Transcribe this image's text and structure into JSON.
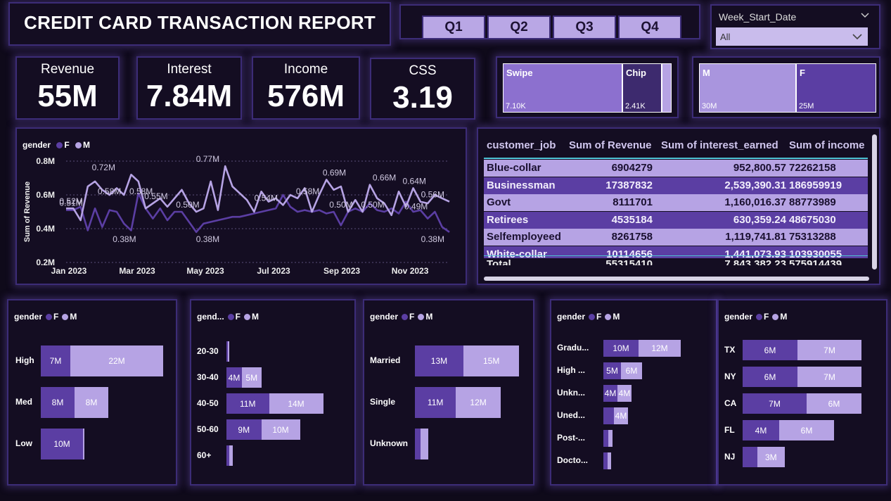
{
  "header": {
    "title": "CREDIT CARD TRANSACTION REPORT"
  },
  "quarters": [
    "Q1",
    "Q2",
    "Q3",
    "Q4"
  ],
  "filter": {
    "label": "Week_Start_Date",
    "value": "All"
  },
  "kpis": [
    {
      "label": "Revenue",
      "value": "55M"
    },
    {
      "label": "Interest",
      "value": "7.84M"
    },
    {
      "label": "Income",
      "value": "576M"
    },
    {
      "label": "CSS",
      "value": "3.19"
    }
  ],
  "card_type": [
    {
      "label": "Swipe",
      "value": "7.10K",
      "color": "#8c70cf"
    },
    {
      "label": "Chip",
      "value": "2.41K",
      "color": "#3d2a6e"
    }
  ],
  "gender_tiles": [
    {
      "label": "M",
      "value": "30M",
      "color": "#8c70cf"
    },
    {
      "label": "F",
      "value": "25M",
      "color": "#5b3ea3"
    }
  ],
  "colors": {
    "F": "#5b3ea3",
    "M": "#b6a3e4",
    "accent": "#3c2c77"
  },
  "legend": {
    "title": "gender",
    "short_title": "gend...",
    "F": "F",
    "M": "M"
  },
  "line_chart": {
    "ylabel": "Sum of Revenue",
    "y_ticks": [
      "0.8M",
      "0.6M",
      "0.4M",
      "0.2M"
    ],
    "x_ticks": [
      "Jan 2023",
      "Mar 2023",
      "May 2023",
      "Jul 2023",
      "Sep 2023",
      "Nov 2023"
    ],
    "annotations": [
      {
        "text": "0.72M",
        "x": 45,
        "y": 0.72
      },
      {
        "text": "0.58M",
        "x": 52,
        "y": 0.58
      },
      {
        "text": "0.58M",
        "x": 90,
        "y": 0.58
      },
      {
        "text": "0.52M",
        "x": 6,
        "y": 0.52
      },
      {
        "text": "0.51M",
        "x": 6,
        "y": 0.51
      },
      {
        "text": "0.55M",
        "x": 108,
        "y": 0.55
      },
      {
        "text": "0.50M",
        "x": 146,
        "y": 0.5
      },
      {
        "text": "0.38M",
        "x": 70,
        "y": 0.38
      },
      {
        "text": "0.77M",
        "x": 170,
        "y": 0.77
      },
      {
        "text": "0.38M",
        "x": 170,
        "y": 0.38
      },
      {
        "text": "0.54M",
        "x": 240,
        "y": 0.54
      },
      {
        "text": "0.58M",
        "x": 290,
        "y": 0.58
      },
      {
        "text": "0.69M",
        "x": 322,
        "y": 0.69
      },
      {
        "text": "0.50M",
        "x": 330,
        "y": 0.5
      },
      {
        "text": "0.50M",
        "x": 368,
        "y": 0.5
      },
      {
        "text": "0.66M",
        "x": 382,
        "y": 0.66
      },
      {
        "text": "0.64M",
        "x": 418,
        "y": 0.64
      },
      {
        "text": "0.49M",
        "x": 420,
        "y": 0.49
      },
      {
        "text": "0.56M",
        "x": 440,
        "y": 0.56
      },
      {
        "text": "0.38M",
        "x": 440,
        "y": 0.38
      }
    ]
  },
  "table": {
    "headers": [
      "customer_job",
      "Sum of Revenue",
      "Sum of interest_earned",
      "Sum of income"
    ],
    "rows": [
      [
        "Blue-collar",
        "6904279",
        "952,800.57",
        "72262158"
      ],
      [
        "Businessman",
        "17387832",
        "2,539,390.31",
        "186959919"
      ],
      [
        "Govt",
        "8111701",
        "1,160,016.37",
        "88773989"
      ],
      [
        "Retirees",
        "4535184",
        "630,359.24",
        "48675030"
      ],
      [
        "Selfemployeed",
        "8261758",
        "1,119,741.81",
        "75313288"
      ],
      [
        "White-collar",
        "10114656",
        "1,441,073.93",
        "103930055"
      ]
    ],
    "total": [
      "Total",
      "55315410",
      "7,843,382.23",
      "575914439"
    ]
  },
  "chart_data": [
    {
      "type": "line",
      "title": "",
      "xlabel": "",
      "ylabel": "Sum of Revenue",
      "ylim": [
        0.2,
        0.8
      ],
      "x_ticks": [
        "Jan 2023",
        "Mar 2023",
        "May 2023",
        "Jul 2023",
        "Sep 2023",
        "Nov 2023"
      ],
      "series": [
        {
          "name": "F",
          "values": [
            0.51,
            0.51,
            0.53,
            0.39,
            0.52,
            0.41,
            0.51,
            0.5,
            0.43,
            0.39,
            0.61,
            0.52,
            0.46,
            0.52,
            0.45,
            0.5,
            0.5,
            0.44,
            0.38,
            0.43,
            0.44,
            0.45,
            0.46,
            0.47,
            0.47,
            0.48,
            0.49,
            0.5,
            0.51,
            0.52,
            0.6,
            0.53,
            0.5,
            0.51,
            0.5,
            0.51,
            0.49,
            0.5,
            0.42,
            0.5,
            0.52,
            0.5,
            0.55,
            0.51,
            0.5,
            0.52,
            0.49,
            0.56,
            0.5,
            0.51,
            0.46,
            0.5,
            0.41,
            0.38
          ]
        },
        {
          "name": "M",
          "values": [
            0.52,
            0.52,
            0.45,
            0.65,
            0.68,
            0.63,
            0.6,
            0.64,
            0.6,
            0.72,
            0.68,
            0.52,
            0.55,
            0.58,
            0.53,
            0.58,
            0.63,
            0.55,
            0.5,
            0.52,
            0.68,
            0.51,
            0.77,
            0.65,
            0.61,
            0.57,
            0.5,
            0.62,
            0.56,
            0.58,
            0.54,
            0.6,
            0.58,
            0.64,
            0.5,
            0.6,
            0.69,
            0.63,
            0.65,
            0.5,
            0.57,
            0.5,
            0.66,
            0.58,
            0.55,
            0.48,
            0.62,
            0.53,
            0.64,
            0.56,
            0.55,
            0.6,
            0.58,
            0.56
          ]
        }
      ]
    },
    {
      "type": "bar",
      "orientation": "horizontal",
      "stacked": true,
      "categories": [
        "High",
        "Med",
        "Low"
      ],
      "series": [
        {
          "name": "F",
          "values": [
            7,
            8,
            10
          ]
        },
        {
          "name": "M",
          "values": [
            22,
            8,
            0.4
          ]
        }
      ],
      "labels": [
        [
          "7M",
          "22M"
        ],
        [
          "8M",
          "8M"
        ],
        [
          "10M",
          ""
        ]
      ]
    },
    {
      "type": "bar",
      "orientation": "horizontal",
      "stacked": true,
      "categories": [
        "20-30",
        "30-40",
        "40-50",
        "50-60",
        "60+"
      ],
      "series": [
        {
          "name": "F",
          "values": [
            0.3,
            4,
            11,
            9,
            0.7
          ]
        },
        {
          "name": "M",
          "values": [
            0.4,
            5,
            14,
            10,
            1.0
          ]
        }
      ],
      "labels": [
        [
          "",
          ""
        ],
        [
          "4M",
          "5M"
        ],
        [
          "11M",
          "14M"
        ],
        [
          "9M",
          "10M"
        ],
        [
          "",
          ""
        ]
      ]
    },
    {
      "type": "bar",
      "orientation": "horizontal",
      "stacked": true,
      "categories": [
        "Married",
        "Single",
        "Unknown"
      ],
      "series": [
        {
          "name": "F",
          "values": [
            13,
            11,
            1.5
          ]
        },
        {
          "name": "M",
          "values": [
            15,
            12,
            2.0
          ]
        }
      ],
      "labels": [
        [
          "13M",
          "15M"
        ],
        [
          "11M",
          "12M"
        ],
        [
          "",
          ""
        ]
      ]
    },
    {
      "type": "bar",
      "orientation": "horizontal",
      "stacked": true,
      "categories": [
        "Gradu...",
        "High ...",
        "Unkn...",
        "Uned...",
        "Post-...",
        "Docto..."
      ],
      "series": [
        {
          "name": "F",
          "values": [
            10,
            5,
            4,
            3,
            1.3,
            1.1
          ]
        },
        {
          "name": "M",
          "values": [
            12,
            6,
            4,
            4,
            1.2,
            1.0
          ]
        }
      ],
      "labels": [
        [
          "10M",
          "12M"
        ],
        [
          "5M",
          "6M"
        ],
        [
          "4M",
          "4M"
        ],
        [
          "",
          "4M"
        ],
        [
          "",
          ""
        ],
        [
          "",
          ""
        ]
      ]
    },
    {
      "type": "bar",
      "orientation": "horizontal",
      "stacked": true,
      "categories": [
        "TX",
        "NY",
        "CA",
        "FL",
        "NJ"
      ],
      "series": [
        {
          "name": "F",
          "values": [
            6,
            6,
            7,
            4,
            1.6
          ]
        },
        {
          "name": "M",
          "values": [
            7,
            7,
            6,
            6,
            3
          ]
        }
      ],
      "labels": [
        [
          "6M",
          "7M"
        ],
        [
          "6M",
          "7M"
        ],
        [
          "7M",
          "6M"
        ],
        [
          "4M",
          "6M"
        ],
        [
          "",
          "3M"
        ]
      ]
    }
  ]
}
